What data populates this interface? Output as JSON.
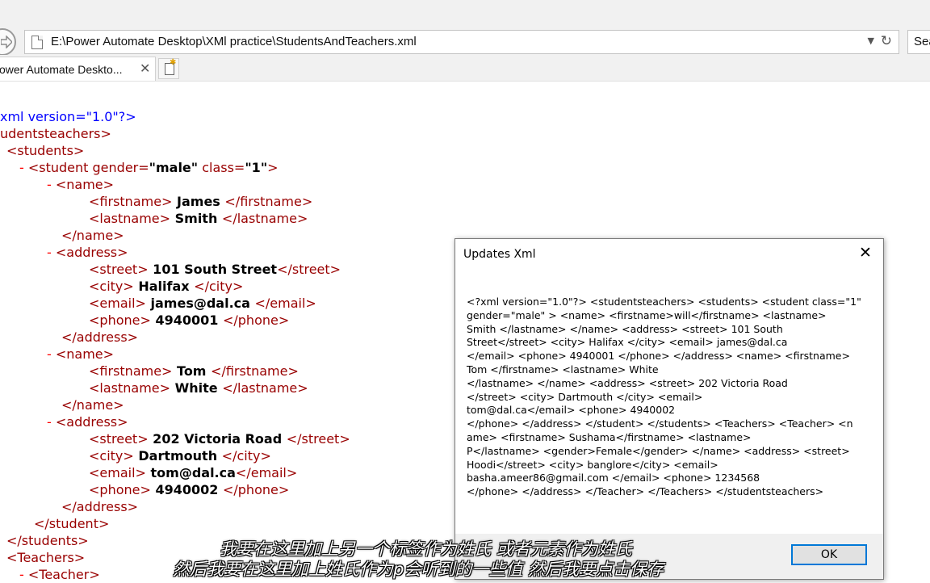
{
  "browser": {
    "address": "E:\\Power Automate Desktop\\XMl practice\\StudentsAndTeachers.xml",
    "search_placeholder": "Sea",
    "tab_title": "ower Automate Deskto...",
    "tab_close": "✕"
  },
  "xml_lines": [
    {
      "indent": 0,
      "dash": false,
      "parts": [
        {
          "c": "pi",
          "t": "xml version=\"1.0\"?>"
        }
      ]
    },
    {
      "indent": 0,
      "dash": false,
      "parts": [
        {
          "c": "tag",
          "t": "udentsteachers>"
        }
      ]
    },
    {
      "indent": 8,
      "dash": false,
      "parts": [
        {
          "c": "tag",
          "t": "<students>"
        }
      ]
    },
    {
      "indent": 24,
      "dash": true,
      "parts": [
        {
          "c": "tag",
          "t": "<student gender="
        },
        {
          "c": "val",
          "t": "\"male\""
        },
        {
          "c": "tag",
          "t": " class="
        },
        {
          "c": "val",
          "t": "\"1\""
        },
        {
          "c": "tag",
          "t": ">"
        }
      ]
    },
    {
      "indent": 58,
      "dash": true,
      "parts": [
        {
          "c": "tag",
          "t": "<name>"
        }
      ]
    },
    {
      "indent": 110,
      "dash": false,
      "parts": [
        {
          "c": "tag",
          "t": "<firstname>"
        },
        {
          "c": "val",
          "t": " James "
        },
        {
          "c": "tag",
          "t": "</firstname>"
        }
      ]
    },
    {
      "indent": 110,
      "dash": false,
      "parts": [
        {
          "c": "tag",
          "t": "<lastname>"
        },
        {
          "c": "val",
          "t": " Smith "
        },
        {
          "c": "tag",
          "t": "</lastname>"
        }
      ]
    },
    {
      "indent": 76,
      "dash": false,
      "parts": [
        {
          "c": "tag",
          "t": "</name>"
        }
      ]
    },
    {
      "indent": 58,
      "dash": true,
      "parts": [
        {
          "c": "tag",
          "t": "<address>"
        }
      ]
    },
    {
      "indent": 110,
      "dash": false,
      "parts": [
        {
          "c": "tag",
          "t": "<street>"
        },
        {
          "c": "val",
          "t": " 101 South Street"
        },
        {
          "c": "tag",
          "t": "</street>"
        }
      ]
    },
    {
      "indent": 110,
      "dash": false,
      "parts": [
        {
          "c": "tag",
          "t": "<city>"
        },
        {
          "c": "val",
          "t": " Halifax "
        },
        {
          "c": "tag",
          "t": "</city>"
        }
      ]
    },
    {
      "indent": 110,
      "dash": false,
      "parts": [
        {
          "c": "tag",
          "t": "<email>"
        },
        {
          "c": "val",
          "t": " james@dal.ca "
        },
        {
          "c": "tag",
          "t": "</email>"
        }
      ]
    },
    {
      "indent": 110,
      "dash": false,
      "parts": [
        {
          "c": "tag",
          "t": "<phone>"
        },
        {
          "c": "val",
          "t": " 4940001 "
        },
        {
          "c": "tag",
          "t": "</phone>"
        }
      ]
    },
    {
      "indent": 76,
      "dash": false,
      "parts": [
        {
          "c": "tag",
          "t": "</address>"
        }
      ]
    },
    {
      "indent": 58,
      "dash": true,
      "parts": [
        {
          "c": "tag",
          "t": "<name>"
        }
      ]
    },
    {
      "indent": 110,
      "dash": false,
      "parts": [
        {
          "c": "tag",
          "t": "<firstname>"
        },
        {
          "c": "val",
          "t": " Tom "
        },
        {
          "c": "tag",
          "t": "</firstname>"
        }
      ]
    },
    {
      "indent": 110,
      "dash": false,
      "parts": [
        {
          "c": "tag",
          "t": "<lastname>"
        },
        {
          "c": "val",
          "t": " White "
        },
        {
          "c": "tag",
          "t": "</lastname>"
        }
      ]
    },
    {
      "indent": 76,
      "dash": false,
      "parts": [
        {
          "c": "tag",
          "t": "</name>"
        }
      ]
    },
    {
      "indent": 58,
      "dash": true,
      "parts": [
        {
          "c": "tag",
          "t": "<address>"
        }
      ]
    },
    {
      "indent": 110,
      "dash": false,
      "parts": [
        {
          "c": "tag",
          "t": "<street>"
        },
        {
          "c": "val",
          "t": " 202 Victoria Road "
        },
        {
          "c": "tag",
          "t": "</street>"
        }
      ]
    },
    {
      "indent": 110,
      "dash": false,
      "parts": [
        {
          "c": "tag",
          "t": "<city>"
        },
        {
          "c": "val",
          "t": " Dartmouth "
        },
        {
          "c": "tag",
          "t": "</city>"
        }
      ]
    },
    {
      "indent": 110,
      "dash": false,
      "parts": [
        {
          "c": "tag",
          "t": "<email>"
        },
        {
          "c": "val",
          "t": " tom@dal.ca"
        },
        {
          "c": "tag",
          "t": "</email>"
        }
      ]
    },
    {
      "indent": 110,
      "dash": false,
      "parts": [
        {
          "c": "tag",
          "t": "<phone>"
        },
        {
          "c": "val",
          "t": " 4940002 "
        },
        {
          "c": "tag",
          "t": "</phone>"
        }
      ]
    },
    {
      "indent": 76,
      "dash": false,
      "parts": [
        {
          "c": "tag",
          "t": "</address>"
        }
      ]
    },
    {
      "indent": 42,
      "dash": false,
      "parts": [
        {
          "c": "tag",
          "t": "</student>"
        }
      ]
    },
    {
      "indent": 8,
      "dash": false,
      "parts": [
        {
          "c": "tag",
          "t": "</students>"
        }
      ]
    },
    {
      "indent": 8,
      "dash": false,
      "parts": [
        {
          "c": "tag",
          "t": "<Teachers>"
        }
      ]
    },
    {
      "indent": 24,
      "dash": true,
      "parts": [
        {
          "c": "tag",
          "t": "<Teacher>"
        }
      ]
    }
  ],
  "dialog": {
    "title": "Updates Xml",
    "close": "✕",
    "message": "<?xml version=\"1.0\"?> <studentsteachers> <students> <student class=\"1\"\ngender=\"male\" > <name> <firstname>will</firstname> <lastname>\nSmith </lastname> </name> <address> <street> 101 South\nStreet</street> <city> Halifax </city> <email> james@dal.ca\n</email> <phone> 4940001 </phone> </address> <name> <firstname>\nTom </firstname> <lastname> White\n</lastname> </name> <address> <street> 202 Victoria Road\n</street> <city> Dartmouth </city> <email>\ntom@dal.ca</email> <phone> 4940002\n</phone> </address> </student> </students> <Teachers> <Teacher> <n\name> <firstname> Sushama</firstname> <lastname>\nP</lastname> <gender>Female</gender> </name> <address> <street>\nHoodi</street> <city> banglore</city> <email>\nbasha.ameer86@gmail.com </email> <phone> 1234568\n</phone> </address> </Teacher> </Teachers> </studentsteachers>",
    "ok_label": "OK"
  },
  "subtitles": {
    "line1": "我要在这里加上另一个标签作为姓氏  或者元素作为姓氏",
    "line2": "然后我要在这里加上姓氏作为p会听到的一些值  然后我要点击保存"
  }
}
